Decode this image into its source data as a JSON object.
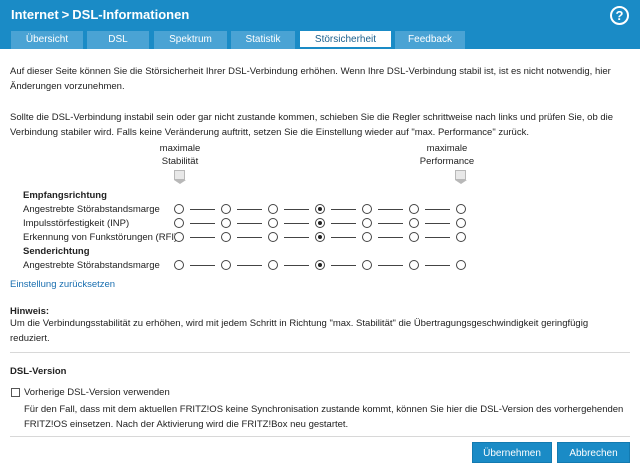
{
  "header": {
    "breadcrumb_root": "Internet",
    "breadcrumb_separator": ">",
    "breadcrumb_page": "DSL-Informationen",
    "help_label": "?",
    "bg_color": "#1a8bc6"
  },
  "tabs": [
    {
      "label": "Übersicht",
      "active": false
    },
    {
      "label": "DSL",
      "active": false
    },
    {
      "label": "Spektrum",
      "active": false
    },
    {
      "label": "Statistik",
      "active": false
    },
    {
      "label": "Störsicherheit",
      "active": true
    },
    {
      "label": "Feedback",
      "active": false
    }
  ],
  "intro": {
    "p1": "Auf dieser Seite können Sie die Störsicherheit Ihrer DSL-Verbindung erhöhen. Wenn Ihre DSL-Verbindung stabil ist, ist es nicht notwendig, hier Änderungen vorzunehmen.",
    "p2": "Sollte die DSL-Verbindung instabil sein oder gar nicht zustande kommen, schieben Sie die Regler schrittweise nach links und prüfen Sie, ob die Verbindung stabiler wird. Falls keine Veränderung auftritt, setzen Sie die Einstellung wieder auf \"max. Performance\" zurück."
  },
  "sliders": {
    "left_head_line1": "maximale",
    "left_head_line2": "Stabilität",
    "right_head_line1": "maximale",
    "right_head_line2": "Performance",
    "steps": 7,
    "group_download": "Empfangsrichtung",
    "group_upload": "Senderichtung",
    "rows": [
      {
        "label": "Angestrebte Störabstandsmarge",
        "selected_step": 3
      },
      {
        "label": "Impulsstörfestigkeit (INP)",
        "selected_step": 3
      },
      {
        "label": "Erkennung von Funkstörungen (RFI)",
        "selected_step": 3
      },
      {
        "label": "Angestrebte Störabstandsmarge",
        "selected_step": 3
      }
    ]
  },
  "reset_link": "Einstellung zurücksetzen",
  "hint": {
    "title": "Hinweis:",
    "text": "Um die Verbindungsstabilität zu erhöhen, wird mit jedem Schritt in Richtung \"max. Stabilität\" die Übertragungsgeschwindigkeit geringfügig reduziert."
  },
  "dsl_version": {
    "title": "DSL-Version",
    "checkbox_label": "Vorherige DSL-Version verwenden",
    "checkbox_checked": false,
    "description": "Für den Fall, dass mit dem aktuellen FRITZ!OS keine Synchronisation zustande kommt, können Sie hier die DSL-Version des vorhergehenden FRITZ!OS einsetzen. Nach der Aktivierung wird die FRITZ!Box neu gestartet."
  },
  "buttons": {
    "apply": "Übernehmen",
    "cancel": "Abbrechen"
  }
}
